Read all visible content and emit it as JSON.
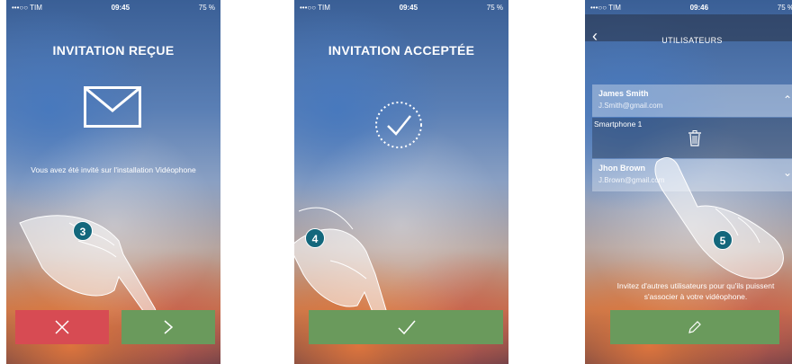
{
  "screens": [
    {
      "status": {
        "carrier": "•••○○ TIM",
        "time": "09:45",
        "battery": "75 %"
      },
      "title": "INVITATION REÇUE",
      "message": "Vous avez été invité sur l'installation Vidéophone",
      "step": "3",
      "buttons": {
        "decline_icon": "close-icon",
        "accept_icon": "chevron-right-icon"
      }
    },
    {
      "status": {
        "carrier": "•••○○ TIM",
        "time": "09:45",
        "battery": "75 %"
      },
      "title": "INVITATION ACCEPTÉE",
      "step": "4",
      "buttons": {
        "confirm_icon": "checkmark-icon"
      }
    },
    {
      "status": {
        "carrier": "•••○○ TIM",
        "time": "09:46",
        "battery": "75 %"
      },
      "title": "UTILISATEURS",
      "users": [
        {
          "name": "James Smith",
          "email": "J.Smith@gmail.com"
        },
        {
          "name": "Jhon Brown",
          "email": "J.Brown@gmail.com"
        }
      ],
      "device": "Smartphone 1",
      "invite_text": "Invitez d'autres utilisateurs pour qu'ils puissent s'associer à votre vidéophone.",
      "step": "5"
    }
  ],
  "colors": {
    "decline": "#d74b53",
    "accept": "#6a9a5c",
    "badge": "#13677c"
  }
}
